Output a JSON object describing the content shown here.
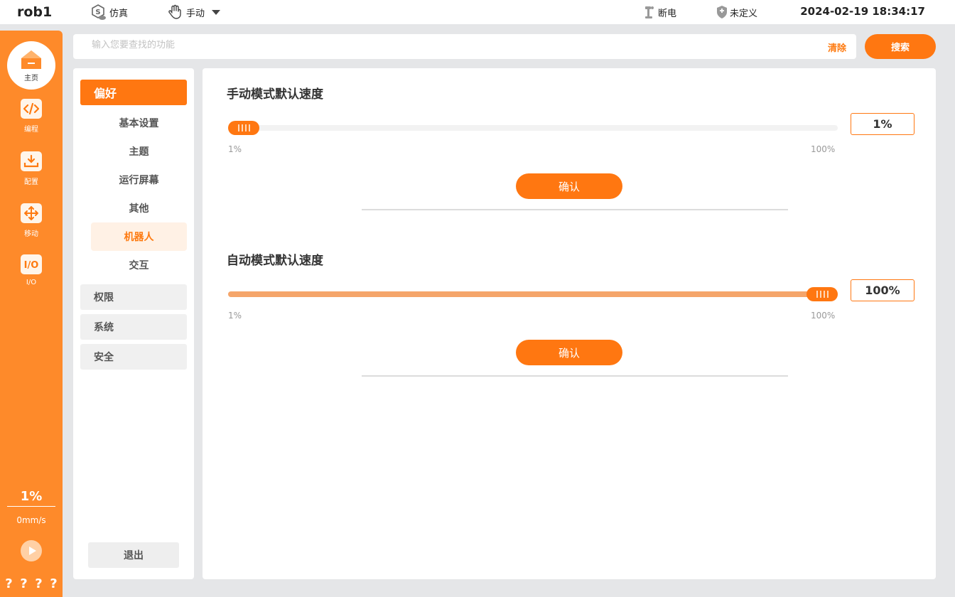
{
  "topbar": {
    "robot_name": "rob1",
    "sim_label": "仿真",
    "mode_label": "手动",
    "power_label": "断电",
    "safety_label": "未定义",
    "datetime": "2024-02-19 18:34:17"
  },
  "sidebar": {
    "home_label": "主页",
    "items": [
      {
        "label": "编程",
        "icon": "code-icon"
      },
      {
        "label": "配置",
        "icon": "config-download-icon"
      },
      {
        "label": "移动",
        "icon": "move-arrows-icon"
      },
      {
        "label": "I/O",
        "icon": "io-icon"
      }
    ],
    "speed_percent": "1%",
    "speed_mm": "0mm/s",
    "question_marks": [
      "?",
      "?",
      "?",
      "?"
    ]
  },
  "search": {
    "placeholder": "输入您要查找的功能",
    "clear_label": "清除",
    "button_label": "搜索"
  },
  "menu": {
    "active_group": "偏好",
    "sub_items": [
      "基本设置",
      "主题",
      "运行屏幕",
      "其他",
      "机器人",
      "交互"
    ],
    "active_sub_index": 4,
    "groups": [
      "权限",
      "系统",
      "安全"
    ],
    "logout_label": "退出"
  },
  "settings": {
    "manual": {
      "title": "手动模式默认速度",
      "value": 1,
      "value_text": "1%",
      "min_label": "1%",
      "max_label": "100%",
      "confirm_label": "确认"
    },
    "auto": {
      "title": "自动模式默认速度",
      "value": 100,
      "value_text": "100%",
      "min_label": "1%",
      "max_label": "100%",
      "confirm_label": "确认"
    }
  },
  "colors": {
    "accent": "#ff7711",
    "sidebar": "#fe8a2a",
    "slider_fill": "#f5a56a",
    "background": "#e5e6e8"
  }
}
